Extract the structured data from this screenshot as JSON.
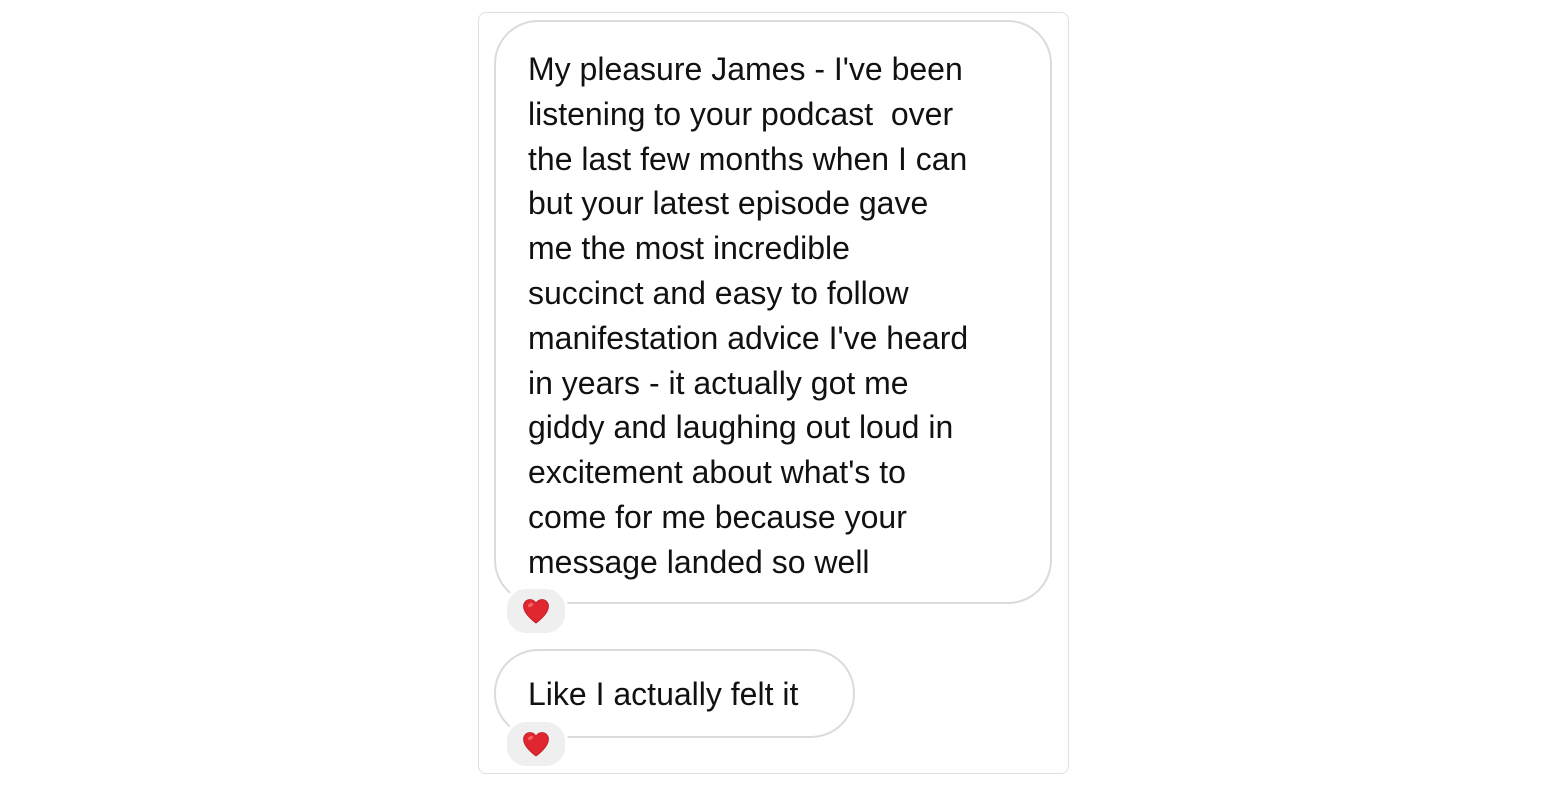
{
  "messages": [
    {
      "lines": [
        "My pleasure James - I've been",
        "listening to your podcast  over",
        "the last few months when I can",
        "but your latest episode gave",
        "me the most incredible",
        "succinct and easy to follow",
        "manifestation advice I've heard",
        "in years - it actually got me",
        "giddy and laughing out loud in",
        "excitement about what's to",
        "come for me because your",
        "message landed so well"
      ],
      "reaction": {
        "icon": "red-heart-icon",
        "color": "#e0262f"
      }
    },
    {
      "lines": [
        "Like I actually felt it"
      ],
      "reaction": {
        "icon": "red-heart-icon",
        "color": "#e0262f"
      }
    }
  ]
}
